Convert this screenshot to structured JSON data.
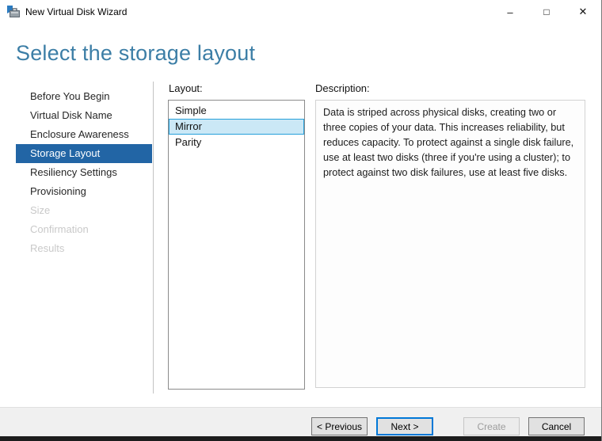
{
  "window": {
    "title": "New Virtual Disk Wizard",
    "controls": {
      "minimize": "–",
      "maximize": "□",
      "close": "✕"
    }
  },
  "page": {
    "heading": "Select the storage layout"
  },
  "sidebar": {
    "items": [
      {
        "label": "Before You Begin",
        "state": "normal"
      },
      {
        "label": "Virtual Disk Name",
        "state": "normal"
      },
      {
        "label": "Enclosure Awareness",
        "state": "normal"
      },
      {
        "label": "Storage Layout",
        "state": "active"
      },
      {
        "label": "Resiliency Settings",
        "state": "normal"
      },
      {
        "label": "Provisioning",
        "state": "normal"
      },
      {
        "label": "Size",
        "state": "disabled"
      },
      {
        "label": "Confirmation",
        "state": "disabled"
      },
      {
        "label": "Results",
        "state": "disabled"
      }
    ]
  },
  "layout_panel": {
    "label": "Layout:",
    "options": [
      {
        "label": "Simple",
        "selected": false
      },
      {
        "label": "Mirror",
        "selected": true
      },
      {
        "label": "Parity",
        "selected": false
      }
    ]
  },
  "description_panel": {
    "label": "Description:",
    "text": "Data is striped across physical disks, creating two or three copies of your data. This increases reliability, but reduces capacity. To protect against a single disk failure, use at least two disks (three if you're using a cluster); to protect against two disk failures, use at least five disks."
  },
  "footer": {
    "buttons": [
      {
        "label": "< Previous",
        "state": "normal"
      },
      {
        "label": "Next >",
        "state": "focused"
      },
      {
        "label": "Create",
        "state": "disabled"
      },
      {
        "label": "Cancel",
        "state": "normal"
      }
    ]
  },
  "colors": {
    "sidebar_active_bg": "#2265a5",
    "heading_blue": "#3c7ea6",
    "selection_bg": "#cbe8f6",
    "selection_border": "#26a0da",
    "focus_border": "#0078d7",
    "footer_bg": "#f0f0f0"
  }
}
